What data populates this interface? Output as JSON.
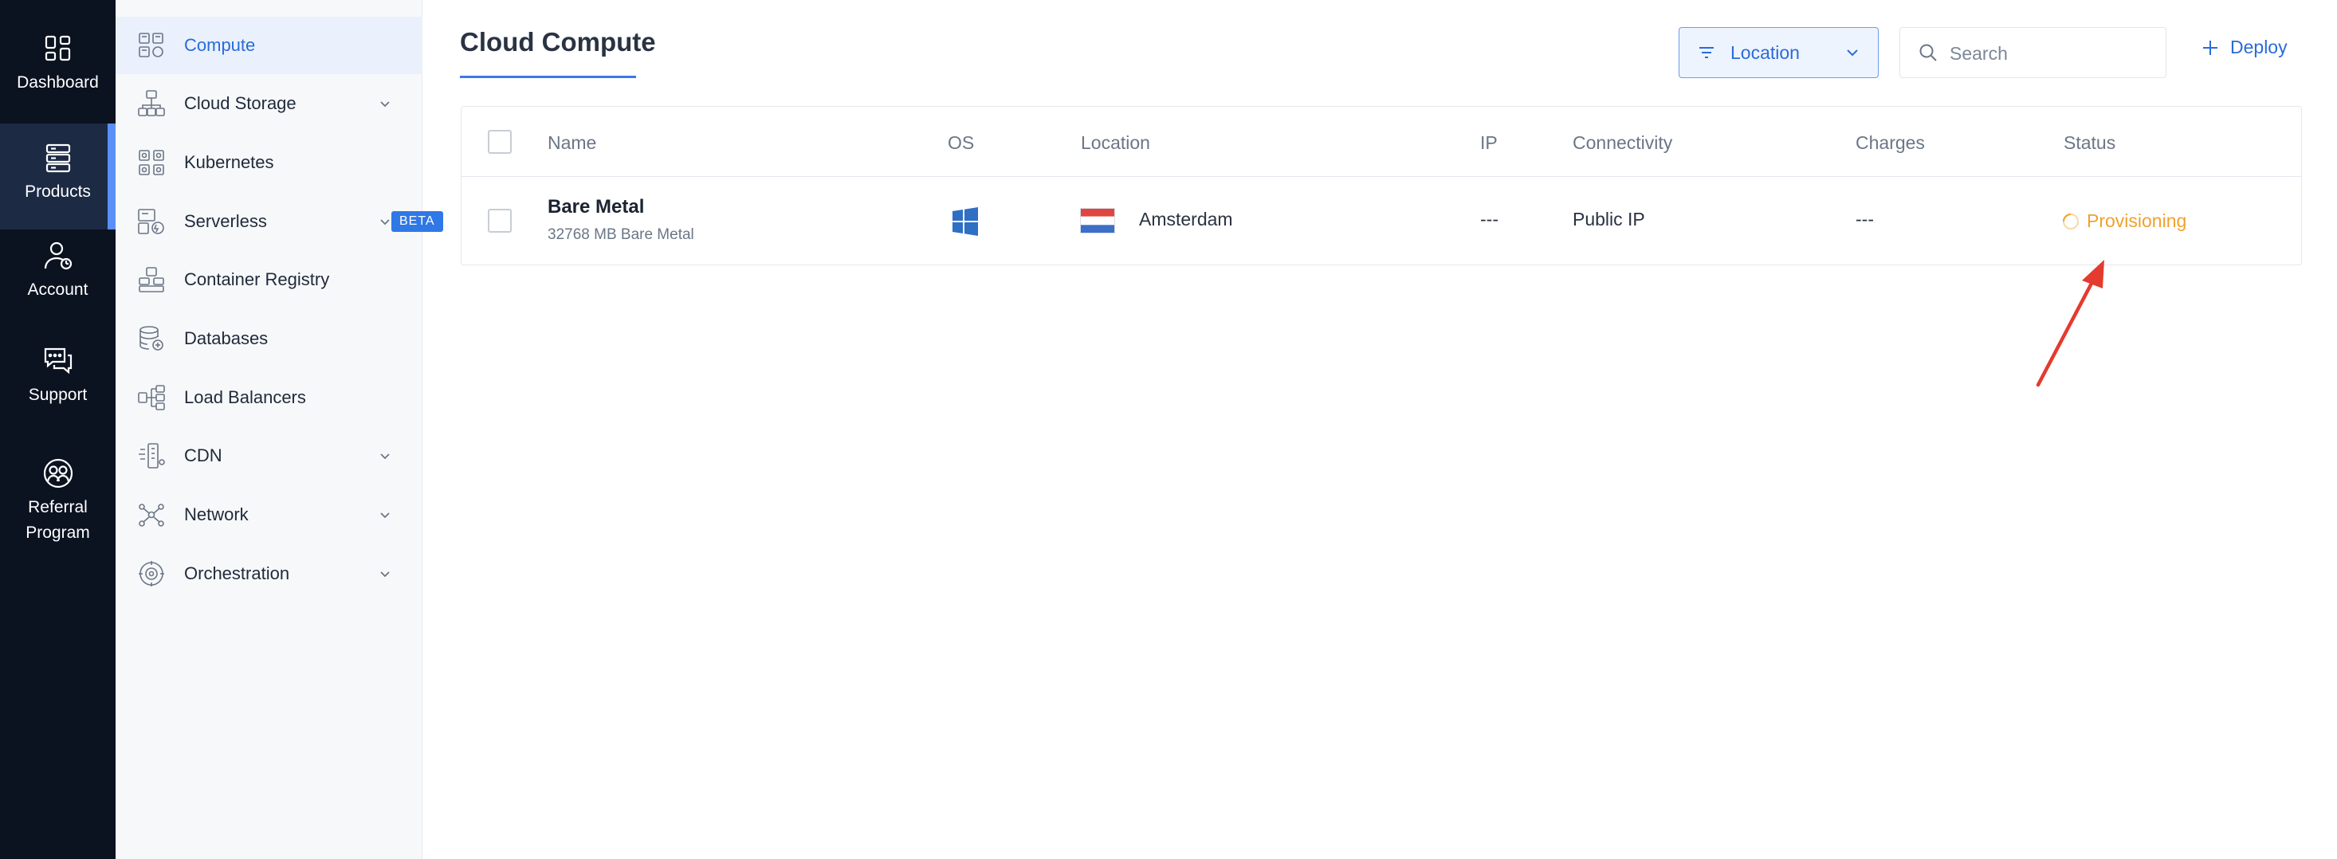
{
  "rail": {
    "items": [
      {
        "label": "Dashboard",
        "icon": "dashboard-icon"
      },
      {
        "label": "Products",
        "icon": "products-icon",
        "active": true
      },
      {
        "label": "Account",
        "icon": "account-icon"
      },
      {
        "label": "Support",
        "icon": "support-icon"
      },
      {
        "label": "Referral Program",
        "icon": "referral-icon"
      }
    ]
  },
  "subnav": {
    "items": [
      {
        "label": "Compute",
        "active": true
      },
      {
        "label": "Cloud Storage",
        "has_children": true
      },
      {
        "label": "Kubernetes"
      },
      {
        "label": "Serverless",
        "badge": "BETA",
        "has_children": true
      },
      {
        "label": "Container Registry"
      },
      {
        "label": "Databases"
      },
      {
        "label": "Load Balancers"
      },
      {
        "label": "CDN",
        "has_children": true
      },
      {
        "label": "Network",
        "has_children": true
      },
      {
        "label": "Orchestration",
        "has_children": true
      }
    ]
  },
  "header": {
    "title": "Cloud Compute",
    "location_filter": "Location",
    "search_placeholder": "Search",
    "deploy_label": "Deploy"
  },
  "table": {
    "columns": [
      "Name",
      "OS",
      "Location",
      "IP",
      "Connectivity",
      "Charges",
      "Status"
    ],
    "rows": [
      {
        "name": "Bare Metal",
        "subtitle": "32768 MB Bare Metal",
        "os_icon": "windows-icon",
        "location": "Amsterdam",
        "flag": "netherlands-flag",
        "ip": "---",
        "connectivity": "Public IP",
        "charges": "---",
        "status": "Provisioning"
      }
    ]
  },
  "colors": {
    "rail_bg": "#0b1220",
    "accent": "#2a6bd9",
    "status_provisioning": "#f0a12e",
    "annotation_arrow": "#e53a2f"
  }
}
